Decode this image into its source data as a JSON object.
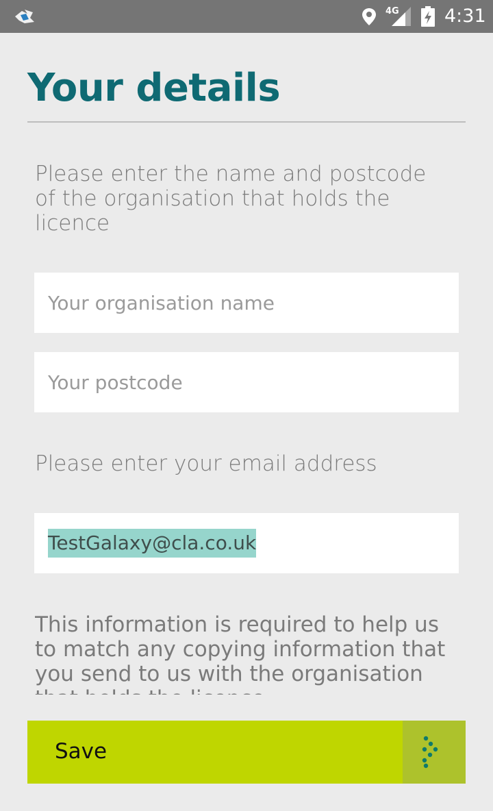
{
  "status_bar": {
    "network": "4G",
    "time": "4:31",
    "icons": [
      "app-notification-icon",
      "location-icon",
      "signal-icon",
      "battery-charging-icon"
    ]
  },
  "header": {
    "title": "Your details"
  },
  "form": {
    "org_instruction": "Please enter the name and postcode of the organisation that holds the licence",
    "org_name_placeholder": "Your organisation name",
    "org_name_value": "",
    "postcode_placeholder": "Your postcode",
    "postcode_value": "",
    "email_instruction": "Please enter your email address",
    "email_value": "TestGalaxy@cla.co.uk",
    "info_text": "This information is required to help us to match any copying information that you send to us with the organisation that holds the licence"
  },
  "actions": {
    "save_label": "Save",
    "save_icon": "chevron-right-dots-icon"
  },
  "colors": {
    "accent": "#0f6a73",
    "button": "#bfd600",
    "button_icon_bg": "#adc22c",
    "selection": "#96d5cc",
    "status_bar": "#757575"
  }
}
